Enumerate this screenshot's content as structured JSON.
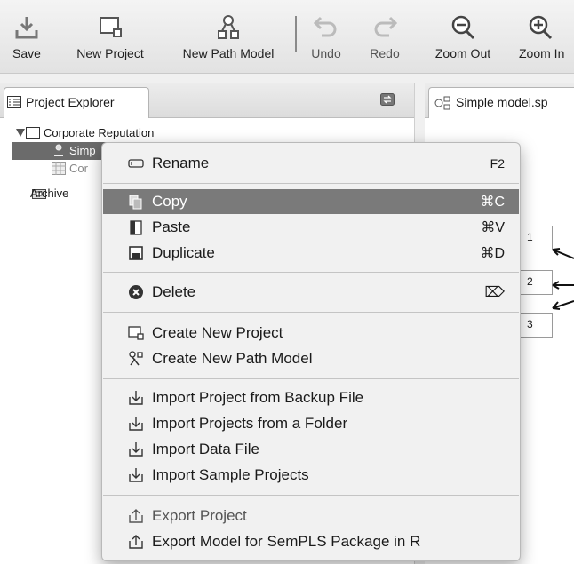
{
  "toolbar": {
    "save": "Save",
    "new_project": "New Project",
    "new_path_model": "New Path Model",
    "undo": "Undo",
    "redo": "Redo",
    "zoom_out": "Zoom Out",
    "zoom_in": "Zoom In"
  },
  "explorer": {
    "tab_label": "Project Explorer",
    "tree": [
      {
        "label": "Corporate Reputation",
        "icon": "folder-open-icon"
      },
      {
        "label": "Simp",
        "icon": "path-model-icon",
        "selected": true
      },
      {
        "label": "Cor",
        "icon": "data-file-icon"
      },
      {
        "label": "Archive",
        "icon": "archive-icon"
      }
    ]
  },
  "canvas": {
    "tab_label": "Simple model.sp",
    "indicators": [
      "1",
      "2",
      "3"
    ]
  },
  "context_menu": {
    "rename": {
      "label": "Rename",
      "shortcut": "F2"
    },
    "copy": {
      "label": "Copy",
      "shortcut": "⌘C"
    },
    "paste": {
      "label": "Paste",
      "shortcut": "⌘V"
    },
    "duplicate": {
      "label": "Duplicate",
      "shortcut": "⌘D"
    },
    "delete": {
      "label": "Delete",
      "shortcut": "⌦"
    },
    "create_new_project": {
      "label": "Create New Project"
    },
    "create_new_path_model": {
      "label": "Create New Path Model"
    },
    "import_backup": {
      "label": "Import Project from Backup File"
    },
    "import_folder": {
      "label": "Import Projects from a Folder"
    },
    "import_data": {
      "label": "Import Data File"
    },
    "import_samples": {
      "label": "Import Sample Projects"
    },
    "export_project": {
      "label": "Export Project"
    },
    "export_model": {
      "label": "Export Model for SemPLS Package in R"
    }
  },
  "colors": {
    "highlight": "#7a7a7a",
    "selected_row": "#6b6b6b",
    "menu_bg": "#f1f1f1"
  }
}
